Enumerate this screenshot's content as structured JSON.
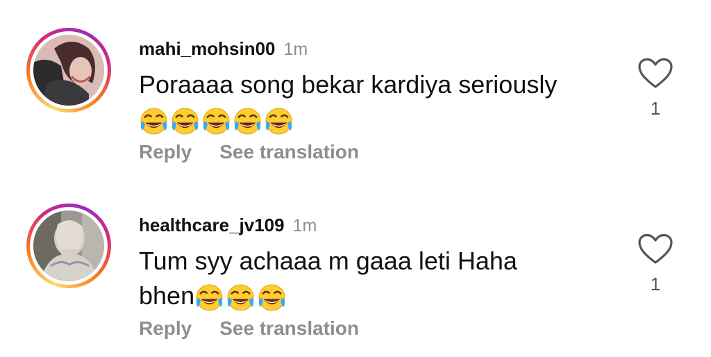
{
  "comments": [
    {
      "username": "mahi_mohsin00",
      "time": "1m",
      "text": "Poraaaa song bekar kardiya seriously",
      "emoji_count": 5,
      "reply_label": "Reply",
      "translate_label": "See translation",
      "like_count": "1",
      "emoji_icon": "face-with-tears-of-joy-icon",
      "like_icon": "heart-outline-icon"
    },
    {
      "username": "healthcare_jv109",
      "time": "1m",
      "text_line1": "Tum syy achaaa m gaaa leti Haha",
      "text_line2": "bhen",
      "emoji_count": 3,
      "reply_label": "Reply",
      "translate_label": "See translation",
      "like_count": "1",
      "emoji_icon": "face-with-tears-of-joy-icon",
      "like_icon": "heart-outline-icon"
    }
  ],
  "colors": {
    "secondary_text": "#8e8e8e",
    "primary_text": "#111111",
    "story_ring": [
      "#feda75",
      "#fa7e1e",
      "#d62976",
      "#962fbf"
    ]
  }
}
